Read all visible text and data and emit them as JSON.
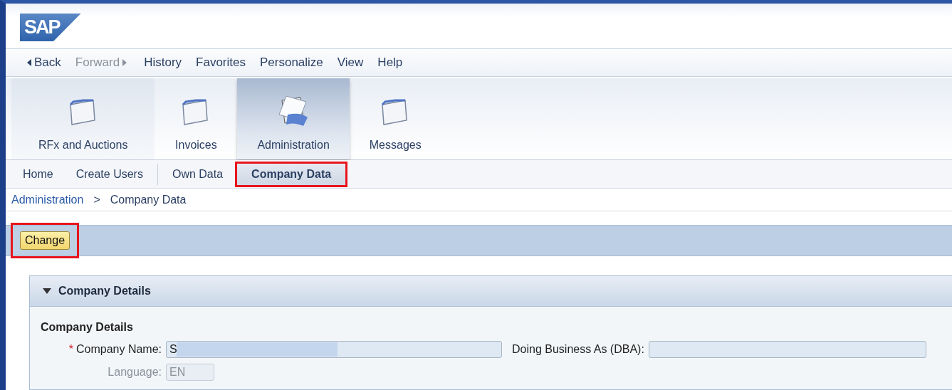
{
  "logo": "SAP",
  "menu": [
    {
      "label": "Back",
      "kind": "back",
      "disabled": false
    },
    {
      "label": "Forward",
      "kind": "forward",
      "disabled": true
    },
    {
      "label": "History",
      "kind": "plain",
      "disabled": false
    },
    {
      "label": "Favorites",
      "kind": "plain",
      "disabled": false
    },
    {
      "label": "Personalize",
      "kind": "plain",
      "disabled": false
    },
    {
      "label": "View",
      "kind": "plain",
      "disabled": false
    },
    {
      "label": "Help",
      "kind": "plain",
      "disabled": false
    }
  ],
  "work_centers": [
    {
      "label": "RFx and Auctions",
      "selected": false
    },
    {
      "label": "Invoices",
      "selected": false
    },
    {
      "label": "Administration",
      "selected": true
    },
    {
      "label": "Messages",
      "selected": false
    }
  ],
  "sub_tabs": [
    {
      "label": "Home",
      "selected": false,
      "highlighted": false
    },
    {
      "label": "Create Users",
      "selected": false,
      "highlighted": false
    },
    {
      "label": "Own Data",
      "selected": false,
      "highlighted": false
    },
    {
      "label": "Company Data",
      "selected": true,
      "highlighted": true
    }
  ],
  "breadcrumb": {
    "link": "Administration",
    "separator": ">",
    "current": "Company Data"
  },
  "toolbar": {
    "button": {
      "label": "Change",
      "highlighted": true
    }
  },
  "panel": {
    "title": "Company Details",
    "expanded": true,
    "section_title": "Company Details",
    "required_mark": "*",
    "fields": [
      {
        "label": "Company Name:",
        "required": true,
        "value": "S",
        "disabled": false,
        "redacted": true
      },
      {
        "label": "Doing Business As (DBA):",
        "required": false,
        "disabled": false,
        "redacted": false
      },
      {
        "label": "Language:",
        "required": false,
        "value": "EN",
        "disabled": true,
        "redacted": false
      }
    ]
  }
}
